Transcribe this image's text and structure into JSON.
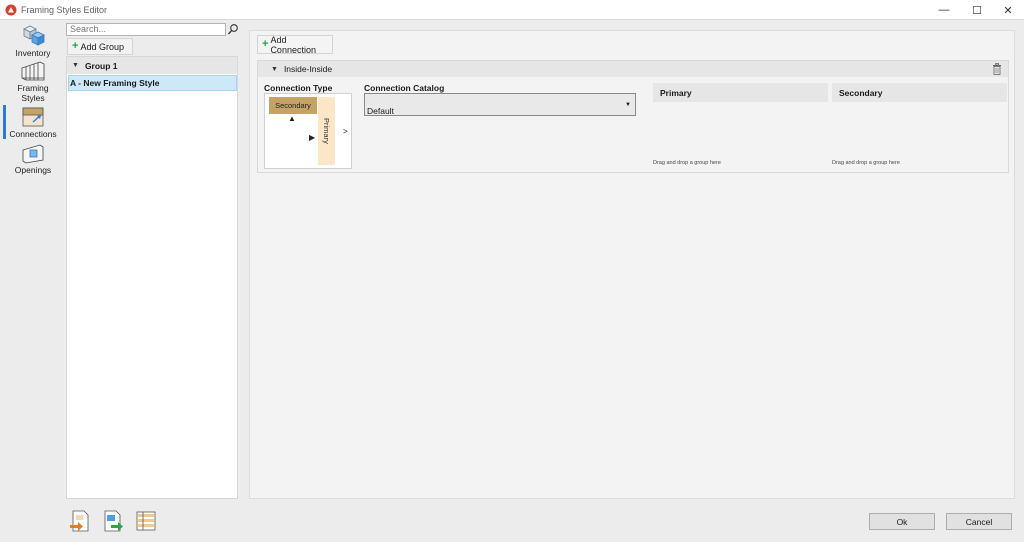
{
  "window": {
    "title": "Framing Styles Editor",
    "controls": {
      "minimize": "—",
      "maximize": "☐",
      "close": "✕"
    }
  },
  "sidebar": {
    "items": [
      {
        "label": "Inventory",
        "icon": "inventory-cube-icon"
      },
      {
        "label": "Framing\nStyles",
        "icon": "framing-styles-icon"
      },
      {
        "label": "Connections",
        "icon": "connections-icon",
        "active": true
      },
      {
        "label": "Openings",
        "icon": "openings-icon"
      }
    ]
  },
  "groups": {
    "search_placeholder": "Search...",
    "add_group_label": "Add Group",
    "group_name": "Group 1",
    "style_name": "A - New Framing Style"
  },
  "main": {
    "add_connection_label": "Add Connection",
    "section_title": "Inside-Inside",
    "connection_type_label": "Connection Type",
    "diagram": {
      "secondary_label": "Secondary",
      "primary_label": "Primary",
      "arrow_up": "▲",
      "arrow_right": "▶",
      "chevron": ">"
    },
    "connection_catalog_label": "Connection Catalog",
    "connection_catalog_value": "Default",
    "primary_header": "Primary",
    "secondary_header": "Secondary",
    "drop_hint": "Drag and drop a group here"
  },
  "footer": {
    "ok_label": "Ok",
    "cancel_label": "Cancel"
  },
  "colors": {
    "accent": "#2b7bd6",
    "selection": "#cde8f7",
    "secondary_member": "#c5a365",
    "primary_member": "#fbe6c8",
    "add_plus": "#27a33c"
  }
}
